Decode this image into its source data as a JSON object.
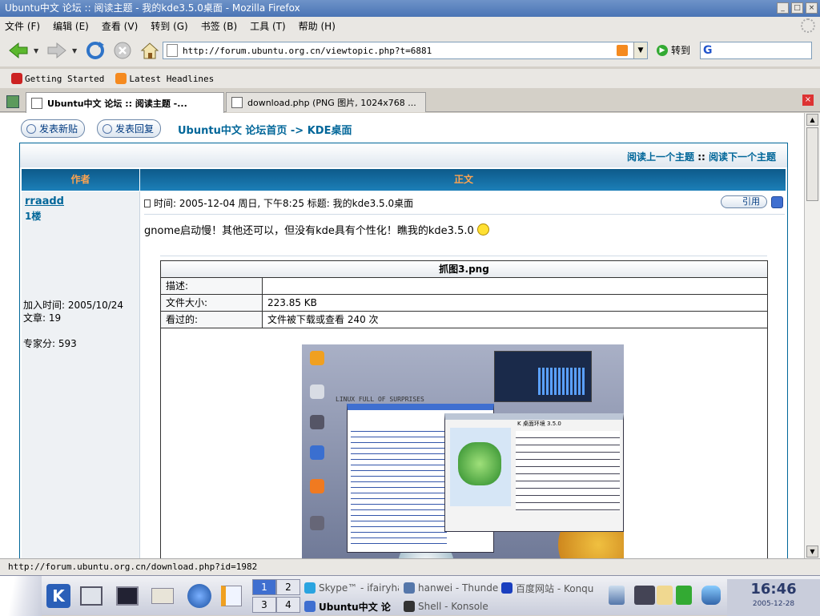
{
  "window": {
    "title": "Ubuntu中文 论坛 :: 阅读主题 - 我的kde3.5.0桌面 - Mozilla Firefox"
  },
  "menu": [
    "文件 (F)",
    "编辑 (E)",
    "查看 (V)",
    "转到 (G)",
    "书签 (B)",
    "工具 (T)",
    "帮助 (H)"
  ],
  "nav": {
    "url": "http://forum.ubuntu.org.cn/viewtopic.php?t=6881",
    "go_label": "转到",
    "search_placeholder": ""
  },
  "bookmarks": [
    {
      "label": "Getting Started",
      "color": "#cc2222"
    },
    {
      "label": "Latest Headlines",
      "color": "#f58a1f"
    }
  ],
  "tabs": [
    {
      "label": "Ubuntu中文 论坛 :: 阅读主题 -..."
    },
    {
      "label": "download.php (PNG 图片, 1024x768 ..."
    }
  ],
  "page": {
    "new_post": "发表新贴",
    "new_post_hl": "新贴",
    "reply": "发表回复",
    "reply_hl": "回复",
    "breadcrumb": "Ubuntu中文 论坛首页 -> KDE桌面",
    "prev_topic": "阅读上一个主题",
    "sep": "::",
    "next_topic": "阅读下一个主题",
    "col_author": "作者",
    "col_body": "正文",
    "author": "rraadd",
    "floor": "1楼",
    "joined": "加入时间: 2005/10/24",
    "posts": "文章: 19",
    "expert": "专家分: 593",
    "post_meta": "时间: 2005-12-04 周日, 下午8:25    标题: 我的kde3.5.0桌面",
    "quote": "引用",
    "post_text": "gnome启动慢！其他还可以，但没有kde具有个性化！瞧我的kde3.5.0",
    "attachment": {
      "title": "抓图3.png",
      "rows": [
        {
          "label": "描述:",
          "value": ""
        },
        {
          "label": "文件大小:",
          "value": "223.85 KB"
        },
        {
          "label": "看过的:",
          "value": "文件被下载或查看 240 次"
        }
      ]
    },
    "shot": {
      "desktop_text": "LINUX FULL OF SURPRISES",
      "kde_title": "K 桌面环境 3.5.0"
    }
  },
  "status": "http://forum.ubuntu.org.cn/download.php?id=1982",
  "taskbar": {
    "pager": [
      "1",
      "2",
      "3",
      "4"
    ],
    "tasks": [
      {
        "label": "Skype™ - ifairyha",
        "color": "#2aa4e0"
      },
      {
        "label": "hanwei - Thunde",
        "color": "#5577aa"
      },
      {
        "label": "Ubuntu中文 论",
        "color": "#3f6fd0"
      },
      {
        "label": "Shell - Konsole",
        "color": "#333333"
      },
      {
        "label": "百度网站 - Konqu",
        "color": "#1a3fbf"
      }
    ],
    "clock": "16:46",
    "date": "2005-12-28"
  }
}
